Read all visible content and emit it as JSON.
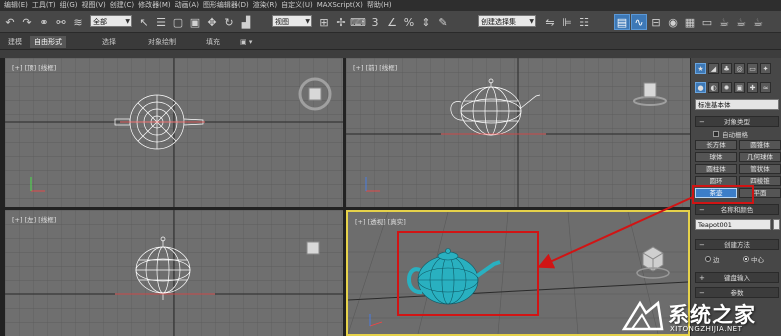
{
  "menubar": {
    "items": [
      "编辑(E)",
      "工具(T)",
      "组(G)",
      "视图(V)",
      "创建(C)",
      "修改器(M)",
      "动画(A)",
      "图形编辑器(D)",
      "渲染(R)",
      "自定义(U)",
      "MAXScript(X)",
      "帮助(H)"
    ]
  },
  "toolbar": {
    "selection_filter": "全部",
    "reference_coord": "视图",
    "named_selection": "创建选择集"
  },
  "ribbon": {
    "tabs": [
      "建模",
      "自由形式",
      "选择",
      "对象绘制",
      "填充"
    ],
    "active_tab": "自由形式"
  },
  "viewports": {
    "top": {
      "label": "[+] [顶] [线框]"
    },
    "front": {
      "label": "[+] [前] [线框]"
    },
    "left": {
      "label": "[+] [左] [线框]"
    },
    "perspective": {
      "label": "[+] [透视] [真实]"
    }
  },
  "command_panel": {
    "category_dropdown": "标准基本体",
    "object_type": {
      "title": "对象类型",
      "autogrid": "自动栅格",
      "buttons": [
        [
          "长方体",
          "圆锥体"
        ],
        [
          "球体",
          "几何球体"
        ],
        [
          "圆柱体",
          "管状体"
        ],
        [
          "圆环",
          "四棱锥"
        ],
        [
          "茶壶",
          "平面"
        ]
      ],
      "selected": "茶壶"
    },
    "name_color": {
      "title": "名称和颜色",
      "object_name": "Teapot001"
    },
    "creation_method": {
      "title": "创建方法",
      "options": [
        "边",
        "中心"
      ],
      "selected": "中心"
    },
    "keyboard_entry": {
      "title": "键盘输入"
    },
    "parameters": {
      "title": "参数"
    }
  },
  "watermark": {
    "cn": "系统之家",
    "en": "XITONGZHIJIA.NET"
  },
  "colors": {
    "viewport_bg": "#6f6f6f",
    "teapot_wire": "#ffffff",
    "teapot_shaded": "#29b0c0",
    "highlight_red": "#d11414",
    "active_border": "#e6d24a",
    "selected_button": "#3c7ec9"
  }
}
